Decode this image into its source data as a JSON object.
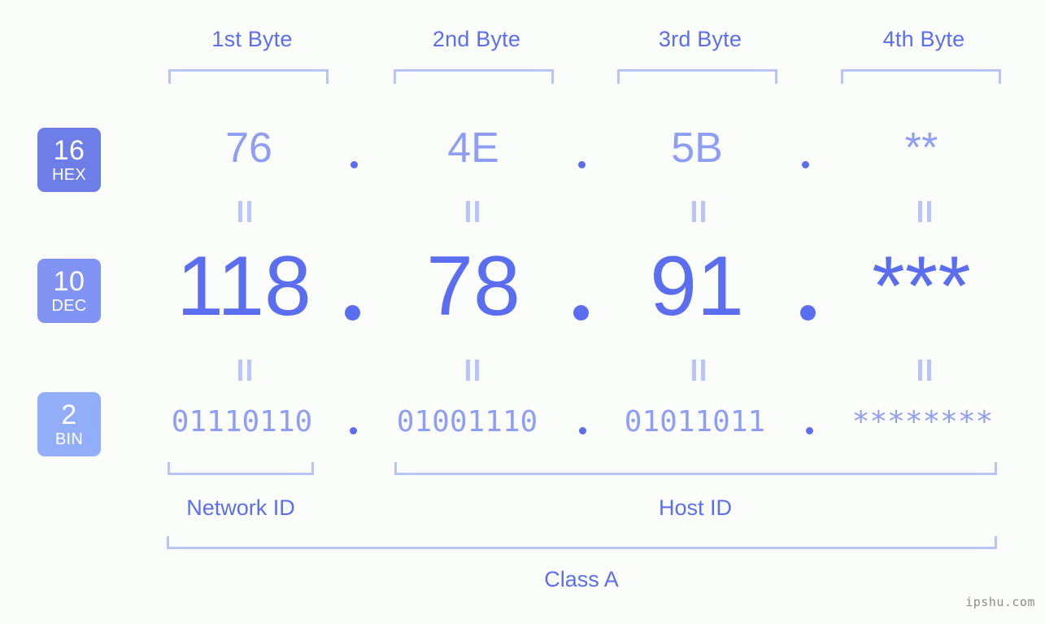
{
  "background_color": "#fbfdfa",
  "accent_color": "#5c6ef0",
  "accent_light": "#8f9ef5",
  "bracket_color": "#b9c4f7",
  "byte_headers": [
    {
      "label": "1st Byte"
    },
    {
      "label": "2nd Byte"
    },
    {
      "label": "3rd Byte"
    },
    {
      "label": "4th Byte"
    }
  ],
  "bases": [
    {
      "num": "16",
      "name": "HEX",
      "color": "#6d7ee8"
    },
    {
      "num": "10",
      "name": "DEC",
      "color": "#8193f3"
    },
    {
      "num": "2",
      "name": "BIN",
      "color": "#93aef8"
    }
  ],
  "rows": {
    "hex": {
      "values": [
        "76",
        "4E",
        "5B",
        "**"
      ],
      "separator": "."
    },
    "dec": {
      "values": [
        "118",
        "78",
        "91",
        "***"
      ],
      "separator": "."
    },
    "bin": {
      "values": [
        "01110110",
        "01001110",
        "01011011",
        "********"
      ],
      "separator": "."
    }
  },
  "equality_symbol": "||",
  "segments": {
    "network_id": "Network ID",
    "host_id": "Host ID",
    "class": "Class A"
  },
  "watermark": "ipshu.com"
}
